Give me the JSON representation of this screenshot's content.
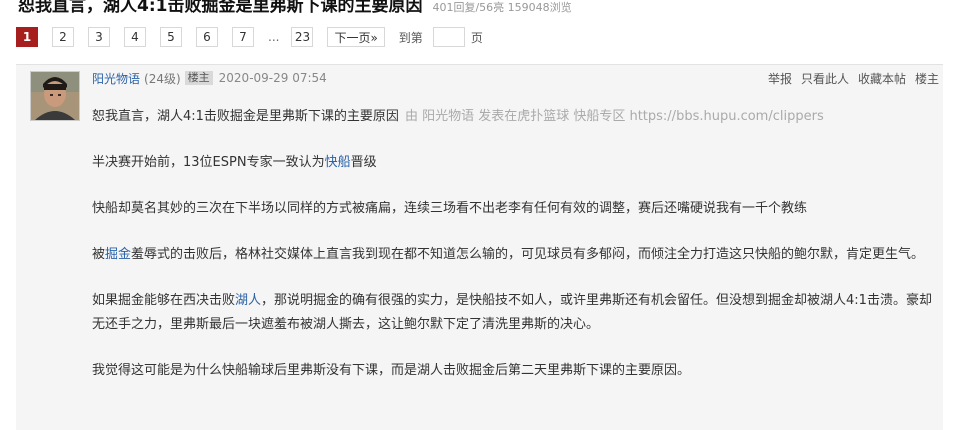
{
  "thread": {
    "title": "恕我直言，湖人4:1击败掘金是里弗斯下课的主要原因",
    "stats": "401回复/56亮 159048浏览"
  },
  "pager": {
    "pages": [
      "1",
      "2",
      "3",
      "4",
      "5",
      "6",
      "7"
    ],
    "ellipsis": "...",
    "last_page": "23",
    "next_label": "下一页»",
    "goto_label": "到第",
    "goto_suffix": "页",
    "current": 1
  },
  "post": {
    "author": "阳光物语",
    "level": "(24级)",
    "tag": "楼主",
    "time": "2020-09-29 07:54",
    "actions": [
      "举报",
      "只看此人",
      "收藏本帖",
      "楼主"
    ],
    "headline": "恕我直言，湖人4:1击败掘金是里弗斯下课的主要原因",
    "source_note": "由 阳光物语 发表在虎扑篮球 快船专区 https://bbs.hupu.com/clippers",
    "p1_a": "半决赛开始前，13位ESPN专家一致认为",
    "p1_link": "快船",
    "p1_b": "晋级",
    "p2": "快船却莫名其妙的三次在下半场以同样的方式被痛扁，连续三场看不出老李有任何有效的调整，赛后还嘴硬说我有一千个教练",
    "p3_a": "被",
    "p3_link": "掘金",
    "p3_b": "羞辱式的击败后，格林社交媒体上直言我到现在都不知道怎么输的，可见球员有多郁闷，而倾注全力打造这只快船的鲍尔默，肯定更生气。",
    "p4_a": "如果掘金能够在西决击败",
    "p4_link": "湖人",
    "p4_b": "，那说明掘金的确有很强的实力，是快船技不如人，或许里弗斯还有机会留任。但没想到掘金却被湖人4:1击溃。豪却无还手之力，里弗斯最后一块遮羞布被湖人撕去，这让鲍尔默下定了清洗里弗斯的决心。",
    "p5": "我觉得这可能是为什么快船输球后里弗斯没有下课，而是湖人击败掘金后第二天里弗斯下课的主要原因。"
  },
  "colors": {
    "active_page": "#a61e1e",
    "link": "#2a62a8",
    "post_background": "#f5f5f5"
  }
}
